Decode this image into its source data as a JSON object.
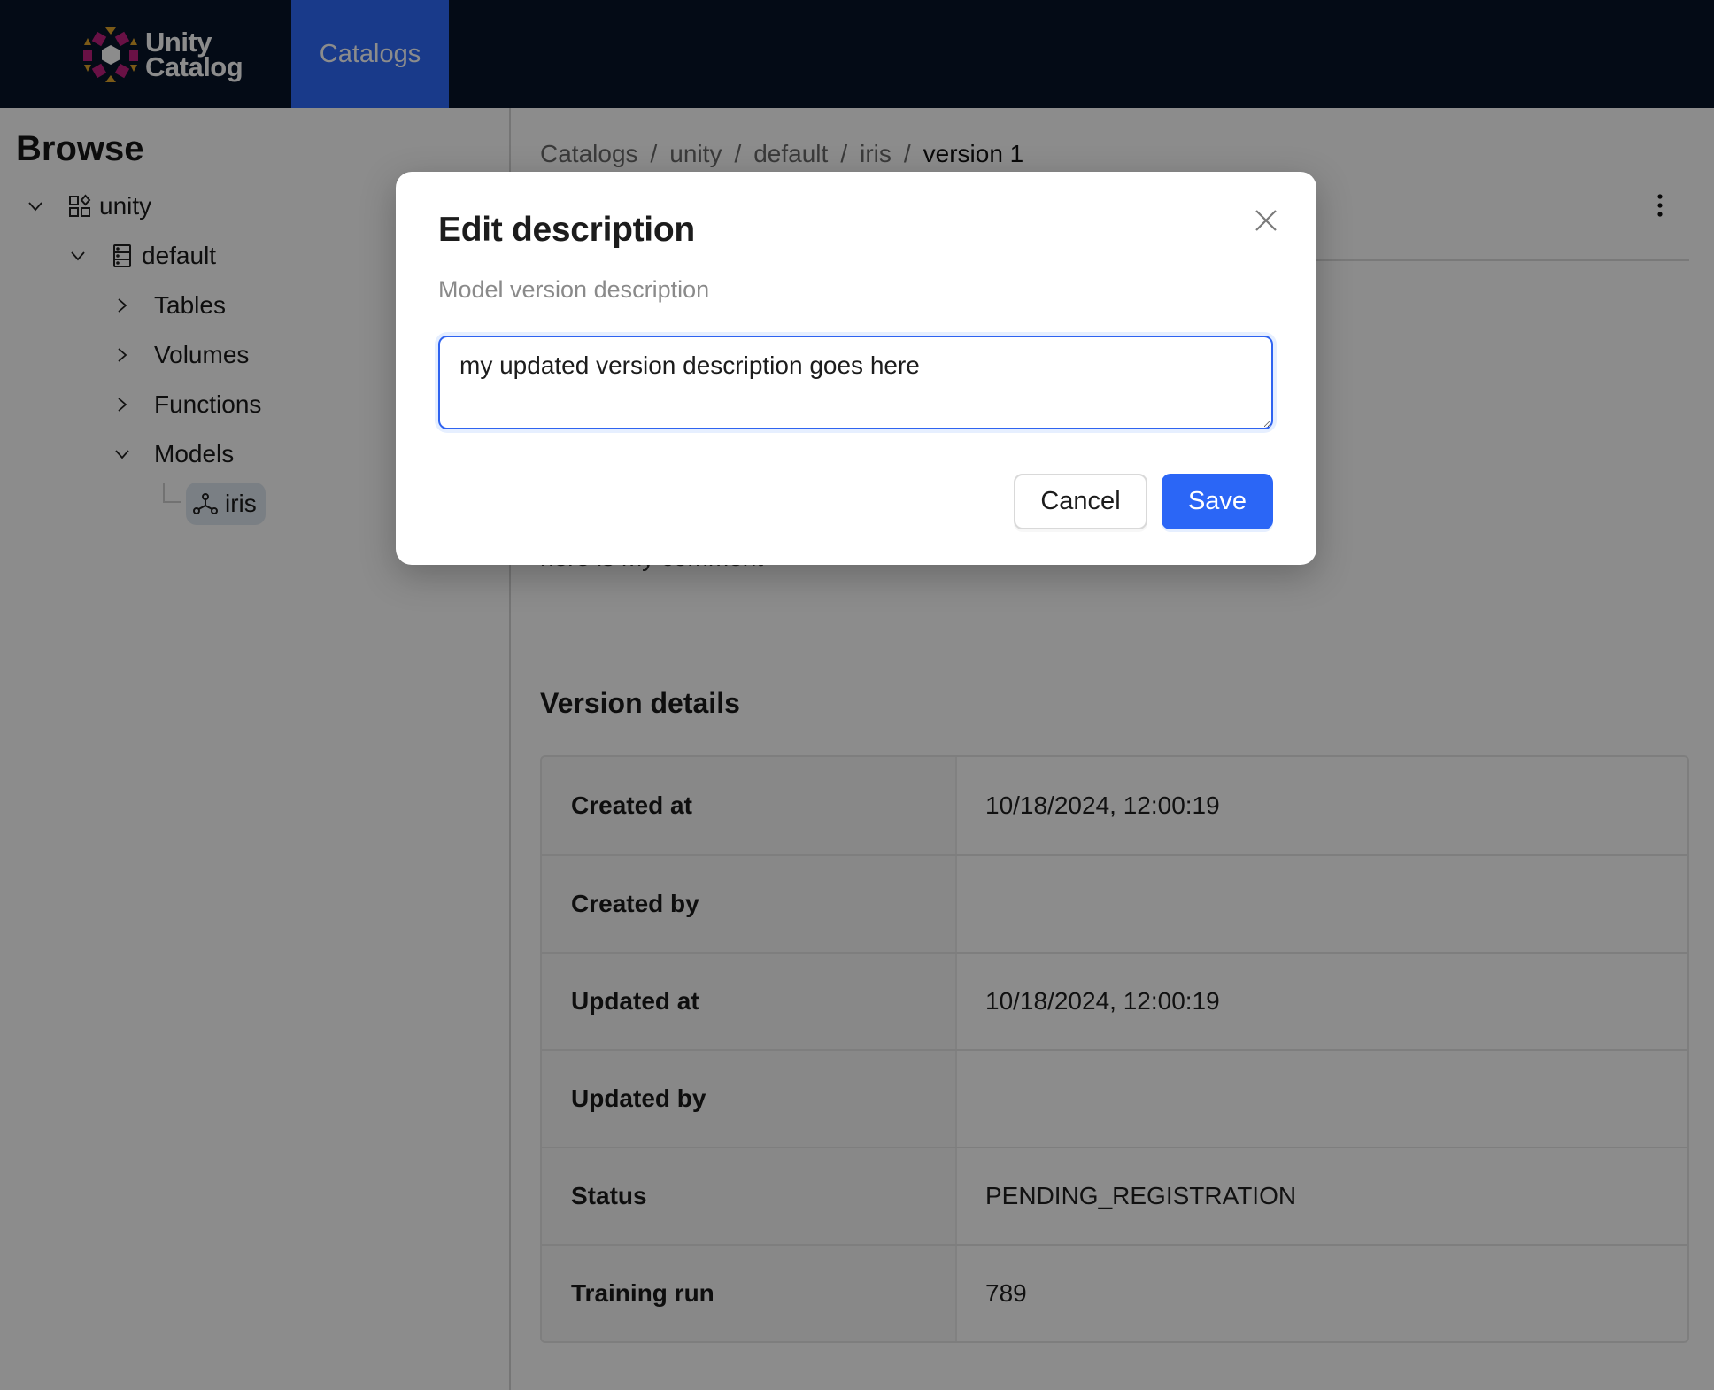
{
  "header": {
    "logo_line1": "Unity",
    "logo_line2": "Catalog",
    "nav_tab": "Catalogs",
    "brand_color": "#2f6bfb"
  },
  "sidebar": {
    "title": "Browse",
    "tree": [
      {
        "label": "unity",
        "icon": "catalog-icon",
        "expanded": true
      },
      {
        "label": "default",
        "icon": "schema-icon",
        "expanded": true
      },
      {
        "label": "Tables",
        "expanded": false
      },
      {
        "label": "Volumes",
        "expanded": false
      },
      {
        "label": "Functions",
        "expanded": false
      },
      {
        "label": "Models",
        "expanded": true
      },
      {
        "label": "iris",
        "icon": "model-icon",
        "selected": true
      }
    ]
  },
  "main": {
    "breadcrumb": [
      "Catalogs",
      "unity",
      "default",
      "iris",
      "version 1"
    ],
    "breadcrumb_separator": "/",
    "comment_text": "here is my comment",
    "section_title": "Version details",
    "details": [
      {
        "label": "Created at",
        "value": "10/18/2024, 12:00:19"
      },
      {
        "label": "Created by",
        "value": ""
      },
      {
        "label": "Updated at",
        "value": "10/18/2024, 12:00:19"
      },
      {
        "label": "Updated by",
        "value": ""
      },
      {
        "label": "Status",
        "value": "PENDING_REGISTRATION"
      },
      {
        "label": "Training run",
        "value": "789"
      }
    ]
  },
  "modal": {
    "title": "Edit description",
    "subtitle": "Model version description",
    "textarea_value": "my updated version description goes here",
    "cancel_label": "Cancel",
    "save_label": "Save",
    "save_color": "#2b66f6"
  }
}
